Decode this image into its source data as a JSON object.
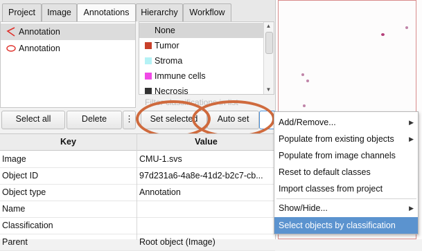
{
  "tabs": [
    "Project",
    "Image",
    "Annotations",
    "Hierarchy",
    "Workflow"
  ],
  "active_tab": "Annotations",
  "annotations": [
    {
      "label": "Annotation",
      "icon": "polygon-icon",
      "selected": true
    },
    {
      "label": "Annotation",
      "icon": "ellipse-icon",
      "selected": false
    }
  ],
  "classes": [
    {
      "label": "None",
      "color": null
    },
    {
      "label": "Tumor",
      "color": "#c8402a"
    },
    {
      "label": "Stroma",
      "color": "#b4f2f5"
    },
    {
      "label": "Immune cells",
      "color": "#f049e6"
    },
    {
      "label": "Necrosis",
      "color": "#333333"
    }
  ],
  "filter_placeholder": "Filter classifications in list",
  "buttons": {
    "select_all": "Select all",
    "delete": "Delete",
    "more": "⋮",
    "set_selected": "Set selected",
    "auto_set": "Auto set"
  },
  "table": {
    "headers": [
      "Key",
      "Value"
    ],
    "rows": [
      [
        "Image",
        "CMU-1.svs"
      ],
      [
        "Object ID",
        "97d231a6-4a8e-41d2-b2c7-cb..."
      ],
      [
        "Object type",
        "Annotation"
      ],
      [
        "Name",
        ""
      ],
      [
        "Classification",
        ""
      ],
      [
        "Parent",
        "Root object (Image)"
      ]
    ]
  },
  "context_menu": {
    "items": [
      {
        "label": "Add/Remove...",
        "submenu": true
      },
      {
        "label": "Populate from existing objects",
        "submenu": true
      },
      {
        "label": "Populate from image channels",
        "submenu": false
      },
      {
        "label": "Reset to default classes",
        "submenu": false
      },
      {
        "label": "Import classes from project",
        "submenu": false
      },
      {
        "label": "Show/Hide...",
        "submenu": true
      },
      {
        "label": "Select objects by classification",
        "submenu": false,
        "highlighted": true
      }
    ]
  },
  "colors": {
    "highlight_ring": "#cf6a3d",
    "menu_highlight": "#5b93cf",
    "border_accent": "#4a90d9"
  }
}
